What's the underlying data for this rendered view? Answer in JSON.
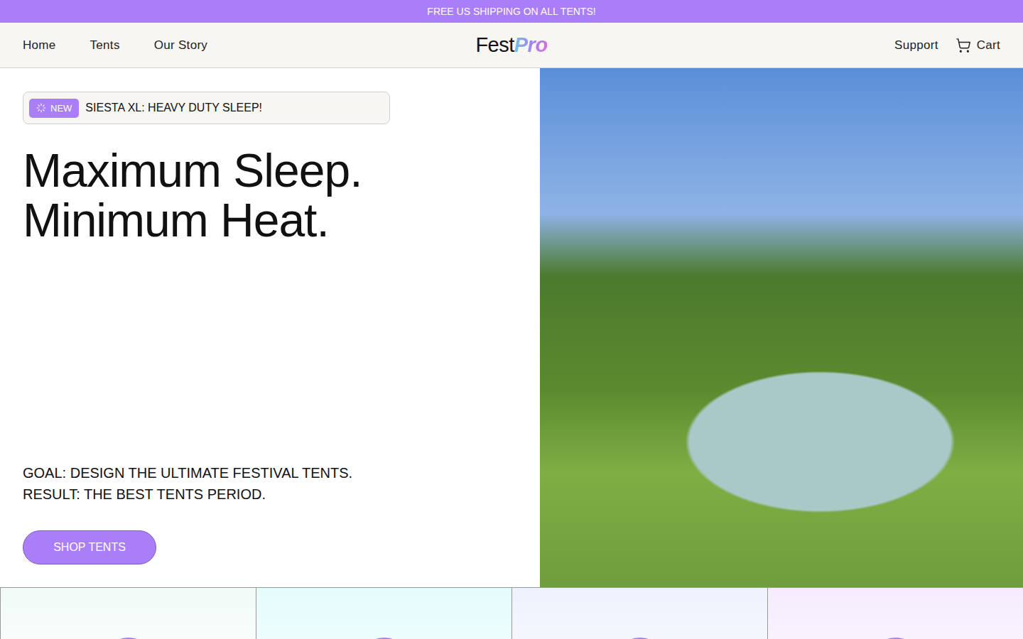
{
  "announcement": "FREE US SHIPPING ON ALL TENTS!",
  "nav": {
    "links": [
      "Home",
      "Tents",
      "Our Story"
    ],
    "brand": {
      "first": "Fest",
      "second": "Pro"
    },
    "support": "Support",
    "cart": "Cart"
  },
  "hero": {
    "badge": {
      "tag": "NEW",
      "text": "SIESTA XL: HEAVY DUTY SLEEP!"
    },
    "heading": [
      "Maximum Sleep.",
      "Minimum Heat."
    ],
    "tagline": [
      "GOAL: DESIGN THE ULTIMATE FESTIVAL TENTS.",
      "RESULT: THE BEST TENTS PERIOD."
    ],
    "button": "SHOP TENTS"
  },
  "cards": [
    {
      "color": "#f2fbf8"
    },
    {
      "color": "#e4fcfd"
    },
    {
      "color": "#eef2fd"
    },
    {
      "color": "#f5ebfd"
    }
  ]
}
